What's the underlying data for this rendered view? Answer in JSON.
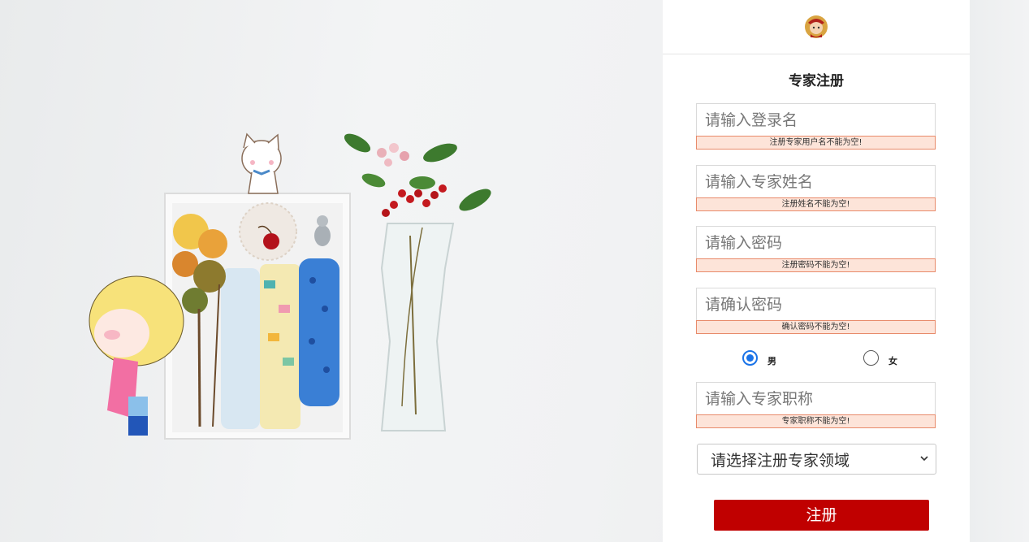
{
  "form": {
    "title": "专家注册",
    "fields": [
      {
        "placeholder": "请输入登录名",
        "error": "注册专家用户名不能为空!"
      },
      {
        "placeholder": "请输入专家姓名",
        "error": "注册姓名不能为空!"
      },
      {
        "placeholder": "请输入密码",
        "error": "注册密码不能为空!"
      },
      {
        "placeholder": "请确认密码",
        "error": "确认密码不能为空!"
      }
    ],
    "gender": {
      "options": [
        {
          "label": "男",
          "checked": true
        },
        {
          "label": "女",
          "checked": false
        }
      ]
    },
    "title_field": {
      "placeholder": "请输入专家职称",
      "error": "专家职称不能为空!"
    },
    "domain_select": {
      "selected": "请选择注册专家领域"
    },
    "submit_label": "注册"
  },
  "colors": {
    "accent": "#c00000",
    "error_bg": "#fde4d9",
    "error_border": "#e88a6a",
    "radio_checked": "#1a73e8"
  },
  "icons": {
    "logo": "avatar-logo-icon",
    "select": "chevron-down-icon"
  }
}
